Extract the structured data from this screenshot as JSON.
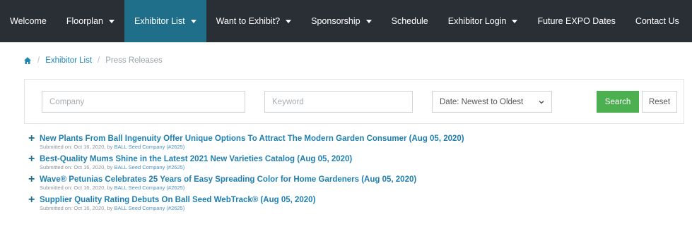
{
  "nav": {
    "items": [
      {
        "label": "Welcome",
        "dropdown": false,
        "active": false
      },
      {
        "label": "Floorplan",
        "dropdown": true,
        "active": false
      },
      {
        "label": "Exhibitor List",
        "dropdown": true,
        "active": true
      },
      {
        "label": "Want to Exhibit?",
        "dropdown": true,
        "active": false
      },
      {
        "label": "Sponsorship",
        "dropdown": true,
        "active": false
      },
      {
        "label": "Schedule",
        "dropdown": false,
        "active": false
      },
      {
        "label": "Exhibitor Login",
        "dropdown": true,
        "active": false
      },
      {
        "label": "Future EXPO Dates",
        "dropdown": false,
        "active": false
      },
      {
        "label": "Contact Us",
        "dropdown": false,
        "active": false
      }
    ]
  },
  "breadcrumb": {
    "home_icon": "home-icon",
    "items": [
      "Exhibitor List",
      "Press Releases"
    ]
  },
  "filters": {
    "company_placeholder": "Company",
    "keyword_placeholder": "Keyword",
    "sort_selected": "Date: Newest to Oldest",
    "search_label": "Search",
    "reset_label": "Reset"
  },
  "colors": {
    "nav_bg": "#2a2f36",
    "nav_active": "#1f6f8b",
    "link": "#1f7fb0",
    "search_btn": "#4caf50"
  },
  "press_releases": [
    {
      "title": "New Plants From Ball Ingenuity Offer Unique Options To Attract The Modern Garden Consumer (Aug 05, 2020)",
      "submitted_prefix": "Submitted on: Oct 16, 2020, by",
      "company": "BALL Seed Company (#2625)"
    },
    {
      "title": "Best-Quality Mums Shine in the Latest 2021 New Varieties Catalog (Aug 05, 2020)",
      "submitted_prefix": "Submitted on: Oct 16, 2020, by",
      "company": "BALL Seed Company (#2625)"
    },
    {
      "title": "Wave® Petunias Celebrates 25 Years of Easy Spreading Color for Home Gardeners (Aug 05, 2020)",
      "submitted_prefix": "Submitted on: Oct 16, 2020, by",
      "company": "BALL Seed Company (#2625)"
    },
    {
      "title": "Supplier Quality Rating Debuts On Ball Seed WebTrack® (Aug 05, 2020)",
      "submitted_prefix": "Submitted on: Oct 16, 2020, by",
      "company": "BALL Seed Company (#2625)"
    }
  ]
}
